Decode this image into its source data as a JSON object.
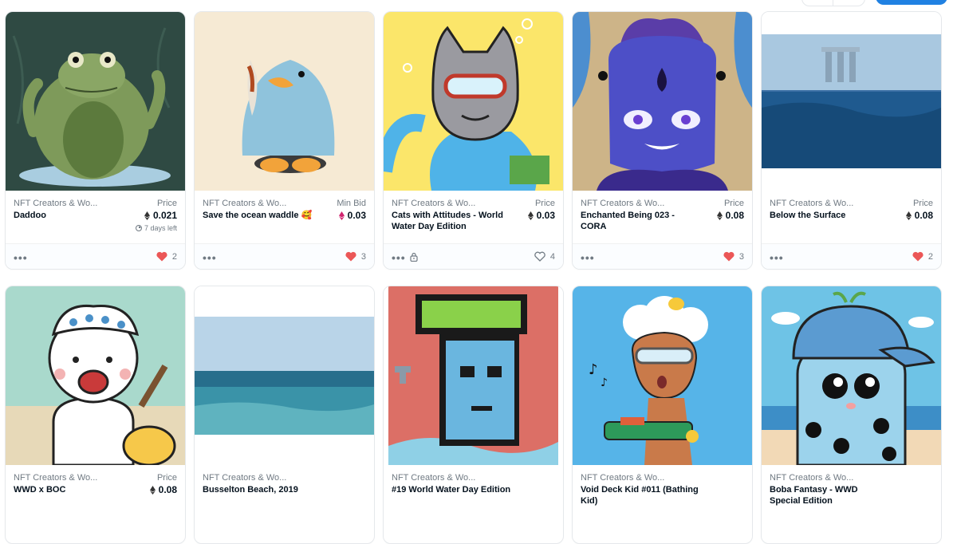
{
  "cards": [
    {
      "collection": "NFT Creators & Wo...",
      "name": "Daddoo",
      "price_label": "Price",
      "price": "0.021",
      "time_left": "7 days left",
      "likes": "2",
      "liked": true
    },
    {
      "collection": "NFT Creators & Wo...",
      "name": "Save the ocean waddle 🥰",
      "price_label": "Min Bid",
      "price": "0.03",
      "likes": "3",
      "liked": true
    },
    {
      "collection": "NFT Creators & Wo...",
      "name": "Cats with Attitudes - World Water Day Edition",
      "price_label": "Price",
      "price": "0.03",
      "likes": "4",
      "liked": false
    },
    {
      "collection": "NFT Creators & Wo...",
      "name": "Enchanted Being 023 - CORA",
      "price_label": "Price",
      "price": "0.08",
      "likes": "3",
      "liked": true
    },
    {
      "collection": "NFT Creators & Wo...",
      "name": "Below the Surface",
      "price_label": "Price",
      "price": "0.08",
      "likes": "2",
      "liked": true
    },
    {
      "collection": "NFT Creators & Wo...",
      "name": "WWD x BOC",
      "price_label": "Price",
      "price": "0.08"
    },
    {
      "collection": "NFT Creators & Wo...",
      "name": "Busselton Beach, 2019"
    },
    {
      "collection": "NFT Creators & Wo...",
      "name": "#19 World Water Day Edition"
    },
    {
      "collection": "NFT Creators & Wo...",
      "name": "Void Deck Kid #011 (Bathing Kid)"
    },
    {
      "collection": "NFT Creators & Wo...",
      "name": "Boba Fantasy - WWD Special Edition"
    }
  ],
  "colors": {
    "accent": "#2081e2",
    "heart": "#eb5757",
    "eth_pink": "#d1246f"
  }
}
